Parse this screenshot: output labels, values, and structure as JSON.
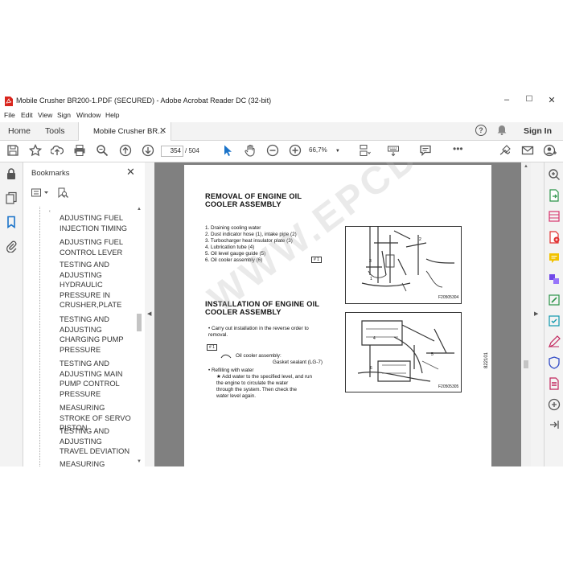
{
  "window": {
    "title": "Mobile Crusher BR200-1.PDF (SECURED) - Adobe Acrobat Reader DC (32-bit)",
    "minimize": "–",
    "maximize": "☐",
    "close": "✕"
  },
  "menu": [
    "File",
    "Edit",
    "View",
    "Sign",
    "Window",
    "Help"
  ],
  "tabs": {
    "home": "Home",
    "tools": "Tools",
    "document": "Mobile Crusher BR...",
    "sign_in": "Sign In"
  },
  "toolbar": {
    "page_current": "354",
    "page_total": "/ 504",
    "zoom": "66,7%"
  },
  "bookmarks": {
    "title": "Bookmarks",
    "items": [
      "ADJUSTING FUEL INJECTION TIMING",
      "ADJUSTING FUEL CONTROL LEVER",
      "TESTING AND ADJUSTING HYDRAULIC PRESSURE IN CRUSHER,PLATE",
      "TESTING AND ADJUSTING CHARGING PUMP PRESSURE",
      "TESTING AND ADJUSTING MAIN PUMP CONTROL PRESSURE",
      "MEASURING STROKE OF SERVO PISTON",
      "TESTING AND ADJUSTING TRAVEL DEVIATION",
      "MEASURING OUTPUT"
    ]
  },
  "document": {
    "removal_title": "REMOVAL OF ENGINE OIL COOLER ASSEMBLY",
    "removal_steps": [
      "1.  Draining cooling water",
      "2.  Dust indicator hose (1), intake pipe (2)",
      "3.  Turbocharger heat insulator plate (3)",
      "4.  Lubrication tube (4)",
      "5.  Oil level gauge guide (5)",
      "6.  Oil cooler assembly (6)"
    ],
    "removal_mark": "# 1",
    "fig1_caption": "F20505304",
    "install_title": "INSTALLATION OF ENGINE OIL COOLER ASSEMBLY",
    "install_lines": [
      "•   Carry out installation in the reverse order to",
      "    removal."
    ],
    "install_mark": "# 1",
    "install_detail": [
      "Oil cooler assembly:",
      "Gasket sealant (LG-7)"
    ],
    "refill_title": "•   Refilling with water",
    "refill_lines": [
      "★  Add water to the specified level, and run",
      "    the engine to circulate the water",
      "    through the system. Then check the",
      "    water level again."
    ],
    "fig2_caption": "F20505305",
    "side_code": "822101",
    "watermark": "WWW.EPCDEPO.COM"
  }
}
